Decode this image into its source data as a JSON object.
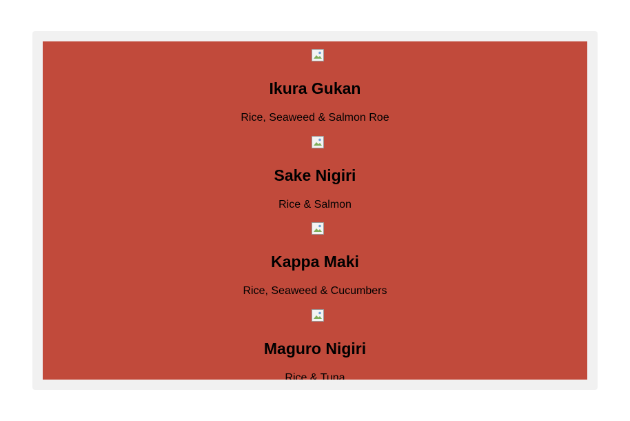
{
  "menu": {
    "items": [
      {
        "name": "Ikura Gukan",
        "description": "Rice, Seaweed & Salmon Roe",
        "image_icon": "broken-image-icon"
      },
      {
        "name": "Sake Nigiri",
        "description": "Rice & Salmon",
        "image_icon": "broken-image-icon"
      },
      {
        "name": "Kappa Maki",
        "description": "Rice, Seaweed & Cucumbers",
        "image_icon": "broken-image-icon"
      },
      {
        "name": "Maguro Nigiri",
        "description": "Rice & Tuna",
        "image_icon": "broken-image-icon"
      }
    ]
  },
  "colors": {
    "panel_background": "#c14a3b",
    "frame_background": "#f1f1f1",
    "text": "#000000"
  }
}
